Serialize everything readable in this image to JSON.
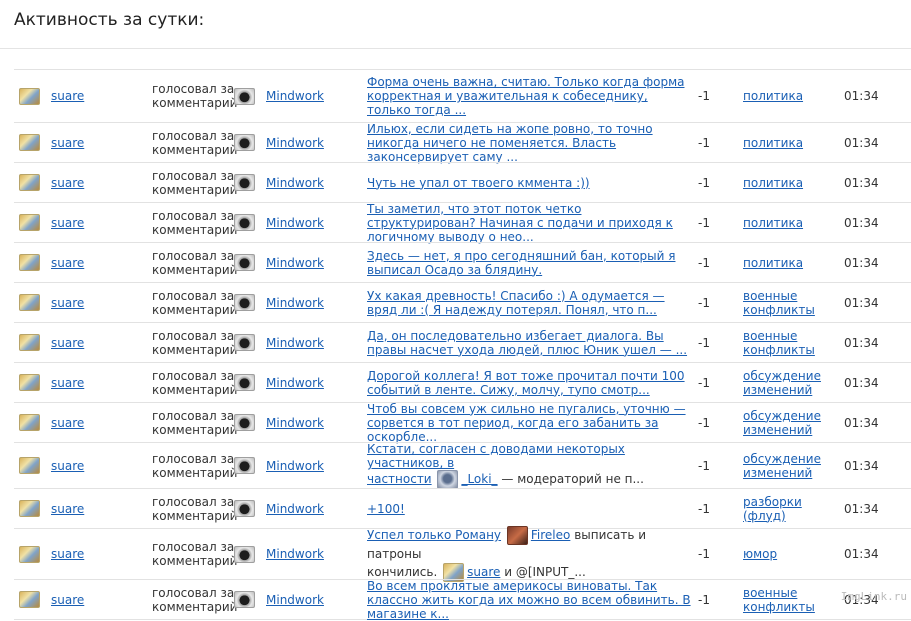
{
  "page": {
    "title": "Активность за сутки:",
    "watermark": "ImgLink.ru"
  },
  "rows": [
    {
      "voter": "suare",
      "action": "голосовал за комментарий",
      "author": "Mindwork",
      "comment": "Форма очень важна, считаю. Только когда форма корректная и уважительная к собеседнику, только тогда ...",
      "score": "-1",
      "topic": "политика",
      "time": "01:34"
    },
    {
      "voter": "suare",
      "action": "голосовал за комментарий",
      "author": "Mindwork",
      "comment": "Ильюх, если сидеть на жопе ровно, то точно никогда ничего не поменяется. Власть законсервирует саму ...",
      "score": "-1",
      "topic": "политика",
      "time": "01:34"
    },
    {
      "voter": "suare",
      "action": "голосовал за комментарий",
      "author": "Mindwork",
      "comment": "Чуть не упал от твоего кммента :))",
      "score": "-1",
      "topic": "политика",
      "time": "01:34"
    },
    {
      "voter": "suare",
      "action": "голосовал за комментарий",
      "author": "Mindwork",
      "comment": "Ты заметил, что этот поток четко структурирован? Начиная с подачи и приходя к логичному выводу о нео...",
      "score": "-1",
      "topic": "политика",
      "time": "01:34"
    },
    {
      "voter": "suare",
      "action": "голосовал за комментарий",
      "author": "Mindwork",
      "comment": "Здесь — нет, я про сегодняшний бан, который я выписал Осадо за блядину.",
      "score": "-1",
      "topic": "политика",
      "time": "01:34"
    },
    {
      "voter": "suare",
      "action": "голосовал за комментарий",
      "author": "Mindwork",
      "comment": "Ух какая древность! Спасибо :) А одумается — вряд ли :( Я надежду потерял. Понял, что п...",
      "score": "-1",
      "topic": "военные конфликты",
      "time": "01:34"
    },
    {
      "voter": "suare",
      "action": "голосовал за комментарий",
      "author": "Mindwork",
      "comment": "Да, он последовательно избегает диалога. Вы правы насчет ухода людей, плюс Юник ушел — ...",
      "score": "-1",
      "topic": "военные конфликты",
      "time": "01:34"
    },
    {
      "voter": "suare",
      "action": "голосовал за комментарий",
      "author": "Mindwork",
      "comment": "Дорогой коллега! Я вот тоже прочитал почти 100 событий в ленте. Сижу, молчу, тупо смотр...",
      "score": "-1",
      "topic": "обсуждение изменений",
      "time": "01:34"
    },
    {
      "voter": "suare",
      "action": "голосовал за комментарий",
      "author": "Mindwork",
      "comment": "Чтоб вы совсем уж сильно не пугались, уточню — сорвется в тот период, когда его забанить за оскорбле...",
      "score": "-1",
      "topic": "обсуждение изменений",
      "time": "01:34"
    },
    {
      "voter": "suare",
      "action": "голосовал за комментарий",
      "author": "Mindwork",
      "comment_parts": {
        "line1": "Кстати, согласен с доводами некоторых участников, в",
        "pre": "частности",
        "mention": "_Loki_",
        "post": "— модераторий не п..."
      },
      "score": "-1",
      "topic": "обсуждение изменений",
      "time": "01:34"
    },
    {
      "voter": "suare",
      "action": "голосовал за комментарий",
      "author": "Mindwork",
      "comment": "+100!",
      "score": "-1",
      "topic": "разборки (флуд)",
      "time": "01:34"
    },
    {
      "voter": "suare",
      "action": "голосовал за комментарий",
      "author": "Mindwork",
      "comment_parts": {
        "pre": "Успел только Роману",
        "mention1": "Fireleo",
        "mid": "выписать и патроны",
        "line2_pre": "кончились.",
        "mention2": "suare",
        "post": "и @[INPUT_..."
      },
      "score": "-1",
      "topic": "юмор",
      "time": "01:34"
    },
    {
      "voter": "suare",
      "action": "голосовал за комментарий",
      "author": "Mindwork",
      "comment": "Во всем проклятые америкосы виноваты. Так классно жить когда их можно во всем обвинить. В магазине к...",
      "score": "-1",
      "topic": "военные конфликты",
      "time": "01:34"
    }
  ]
}
